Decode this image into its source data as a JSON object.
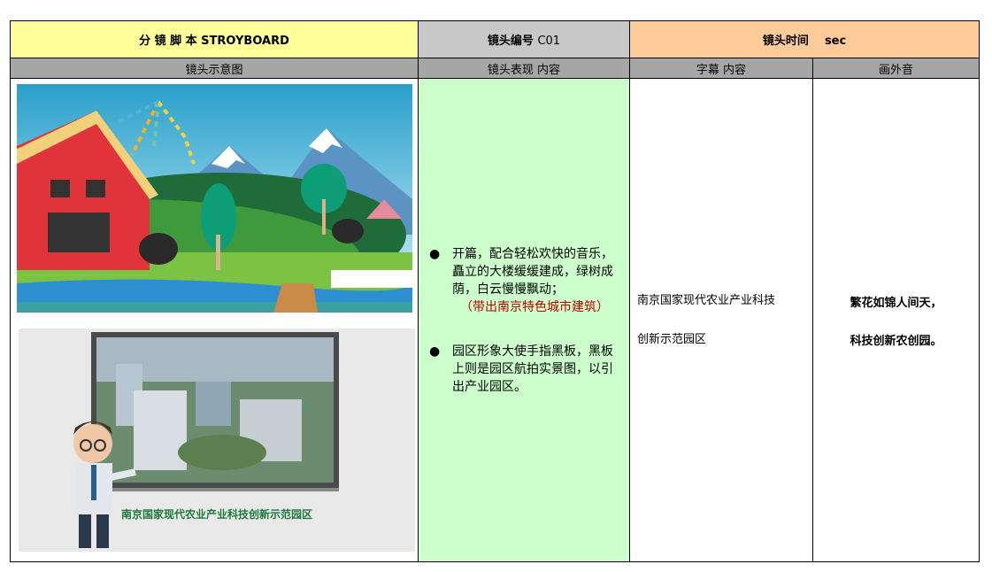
{
  "header": {
    "storyboard_title": "分 镜 脚 本 STROYBOARD",
    "shot_number_label": "镜头编号",
    "shot_number_value": "C01",
    "shot_time_label": "镜头时间",
    "shot_time_unit": "sec"
  },
  "columns": {
    "sketch": "镜头示意图",
    "performance": "镜头表现 内容",
    "subtitle": "字幕 内容",
    "voiceover": "画外音"
  },
  "performance_items": [
    {
      "text": "开篇，配合轻松欢快的音乐，矗立的大楼缓缓建成，绿树成荫，白云慢慢飘动；",
      "note": "（带出南京特色城市建筑）"
    },
    {
      "text": "园区形象大使手指黑板，黑板上则是园区航拍实景图，以引出产业园区。"
    }
  ],
  "subtitle_lines": [
    "南京国家现代农业产业科技",
    "创新示范园区"
  ],
  "voiceover_lines": [
    "繁花如锦人间天，",
    "科技创新农创园。"
  ],
  "image2_caption": "南京国家现代农业产业科技创新示范园区",
  "bullet_symbol": "●",
  "colors": {
    "header_yellow": "#ffff99",
    "header_gray": "#c8c8c8",
    "header_orange": "#ffcc99",
    "subheader_gray": "#a6a6a6",
    "performance_green": "#ccffcc",
    "note_red": "#c00000"
  }
}
